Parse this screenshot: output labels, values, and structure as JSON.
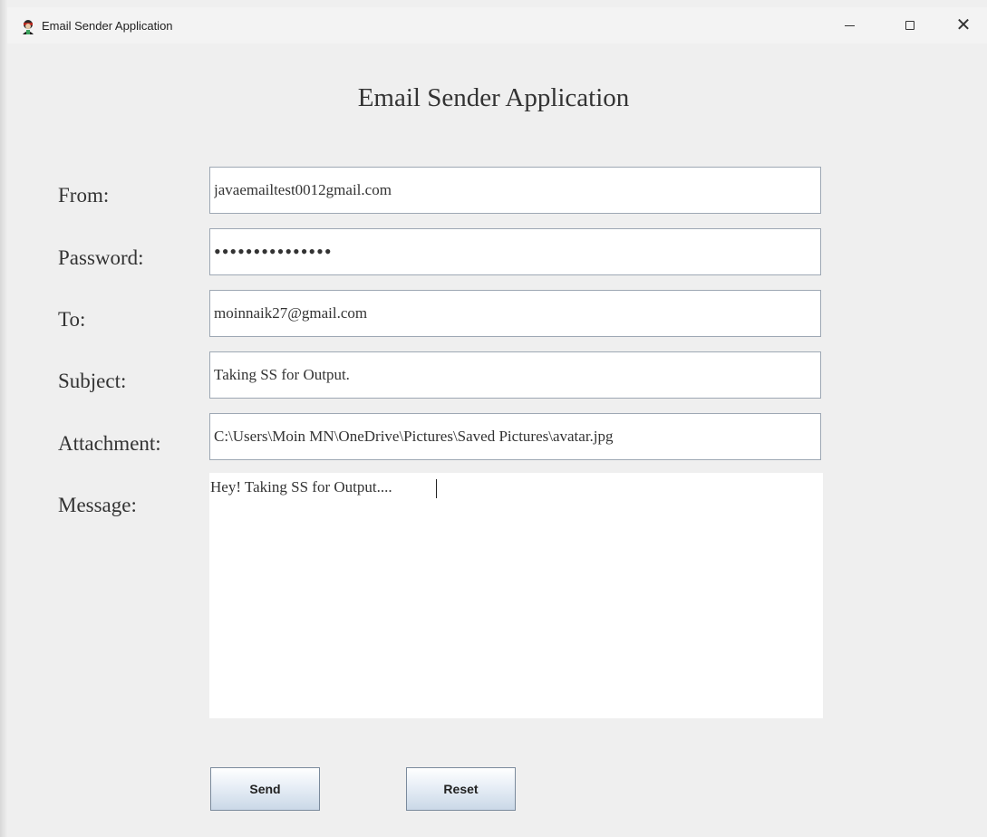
{
  "window": {
    "title": "Email Sender Application",
    "controls": {
      "minimize_icon": "minimize-icon",
      "maximize_icon": "maximize-icon",
      "close_icon": "close-icon",
      "close_glyph": "✕"
    }
  },
  "heading": "Email Sender Application",
  "form": {
    "from": {
      "label": "From:",
      "value": "javaemailtest0012gmail.com"
    },
    "password": {
      "label": "Password:",
      "value": "•••••••••••••••"
    },
    "to": {
      "label": "To:",
      "value": "moinnaik27@gmail.com"
    },
    "subject": {
      "label": "Subject:",
      "value": "Taking SS for Output."
    },
    "attachment": {
      "label": "Attachment:",
      "value": "C:\\Users\\Moin MN\\OneDrive\\Pictures\\Saved Pictures\\avatar.jpg"
    },
    "message": {
      "label": "Message:",
      "value": "Hey! Taking SS for Output...."
    }
  },
  "buttons": {
    "send": "Send",
    "reset": "Reset"
  },
  "colors": {
    "background": "#efefef",
    "field_border": "#9ea8b4",
    "button_gradient_bottom": "#cad8e7"
  }
}
